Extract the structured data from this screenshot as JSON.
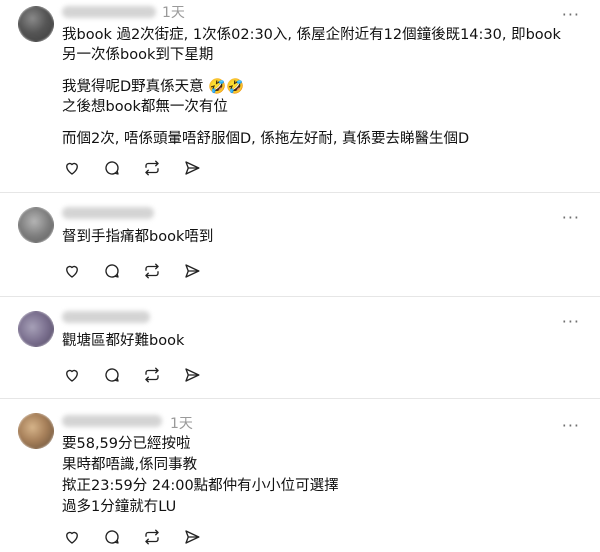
{
  "posts": [
    {
      "time": "1天",
      "lines": [
        "我book 過2次街症, 1次係02:30入, 係屋企附近有12個鐘後既14:30, 即book",
        "另一次係book到下星期",
        "",
        "我覺得呢D野真係天意 🤣🤣",
        "之後想book都無一次有位",
        "",
        "而個2次, 唔係頭暈唔舒服個D, 係拖左好耐, 真係要去睇醫生個D"
      ]
    },
    {
      "time": "",
      "lines": [
        "督到手指痛都book唔到"
      ]
    },
    {
      "time": "",
      "lines": [
        "觀塘區都好難book"
      ]
    },
    {
      "time": "1天",
      "lines": [
        "要58,59分已經按啦",
        "果時都唔識,係同事教",
        "揿正23:59分 24:00點都仲有小小位可選擇",
        "過多1分鐘就冇LU"
      ]
    }
  ],
  "more_label": "···",
  "colors": {
    "text": "#111111",
    "muted": "#9a9a9a",
    "divider": "#e6e6e6"
  }
}
